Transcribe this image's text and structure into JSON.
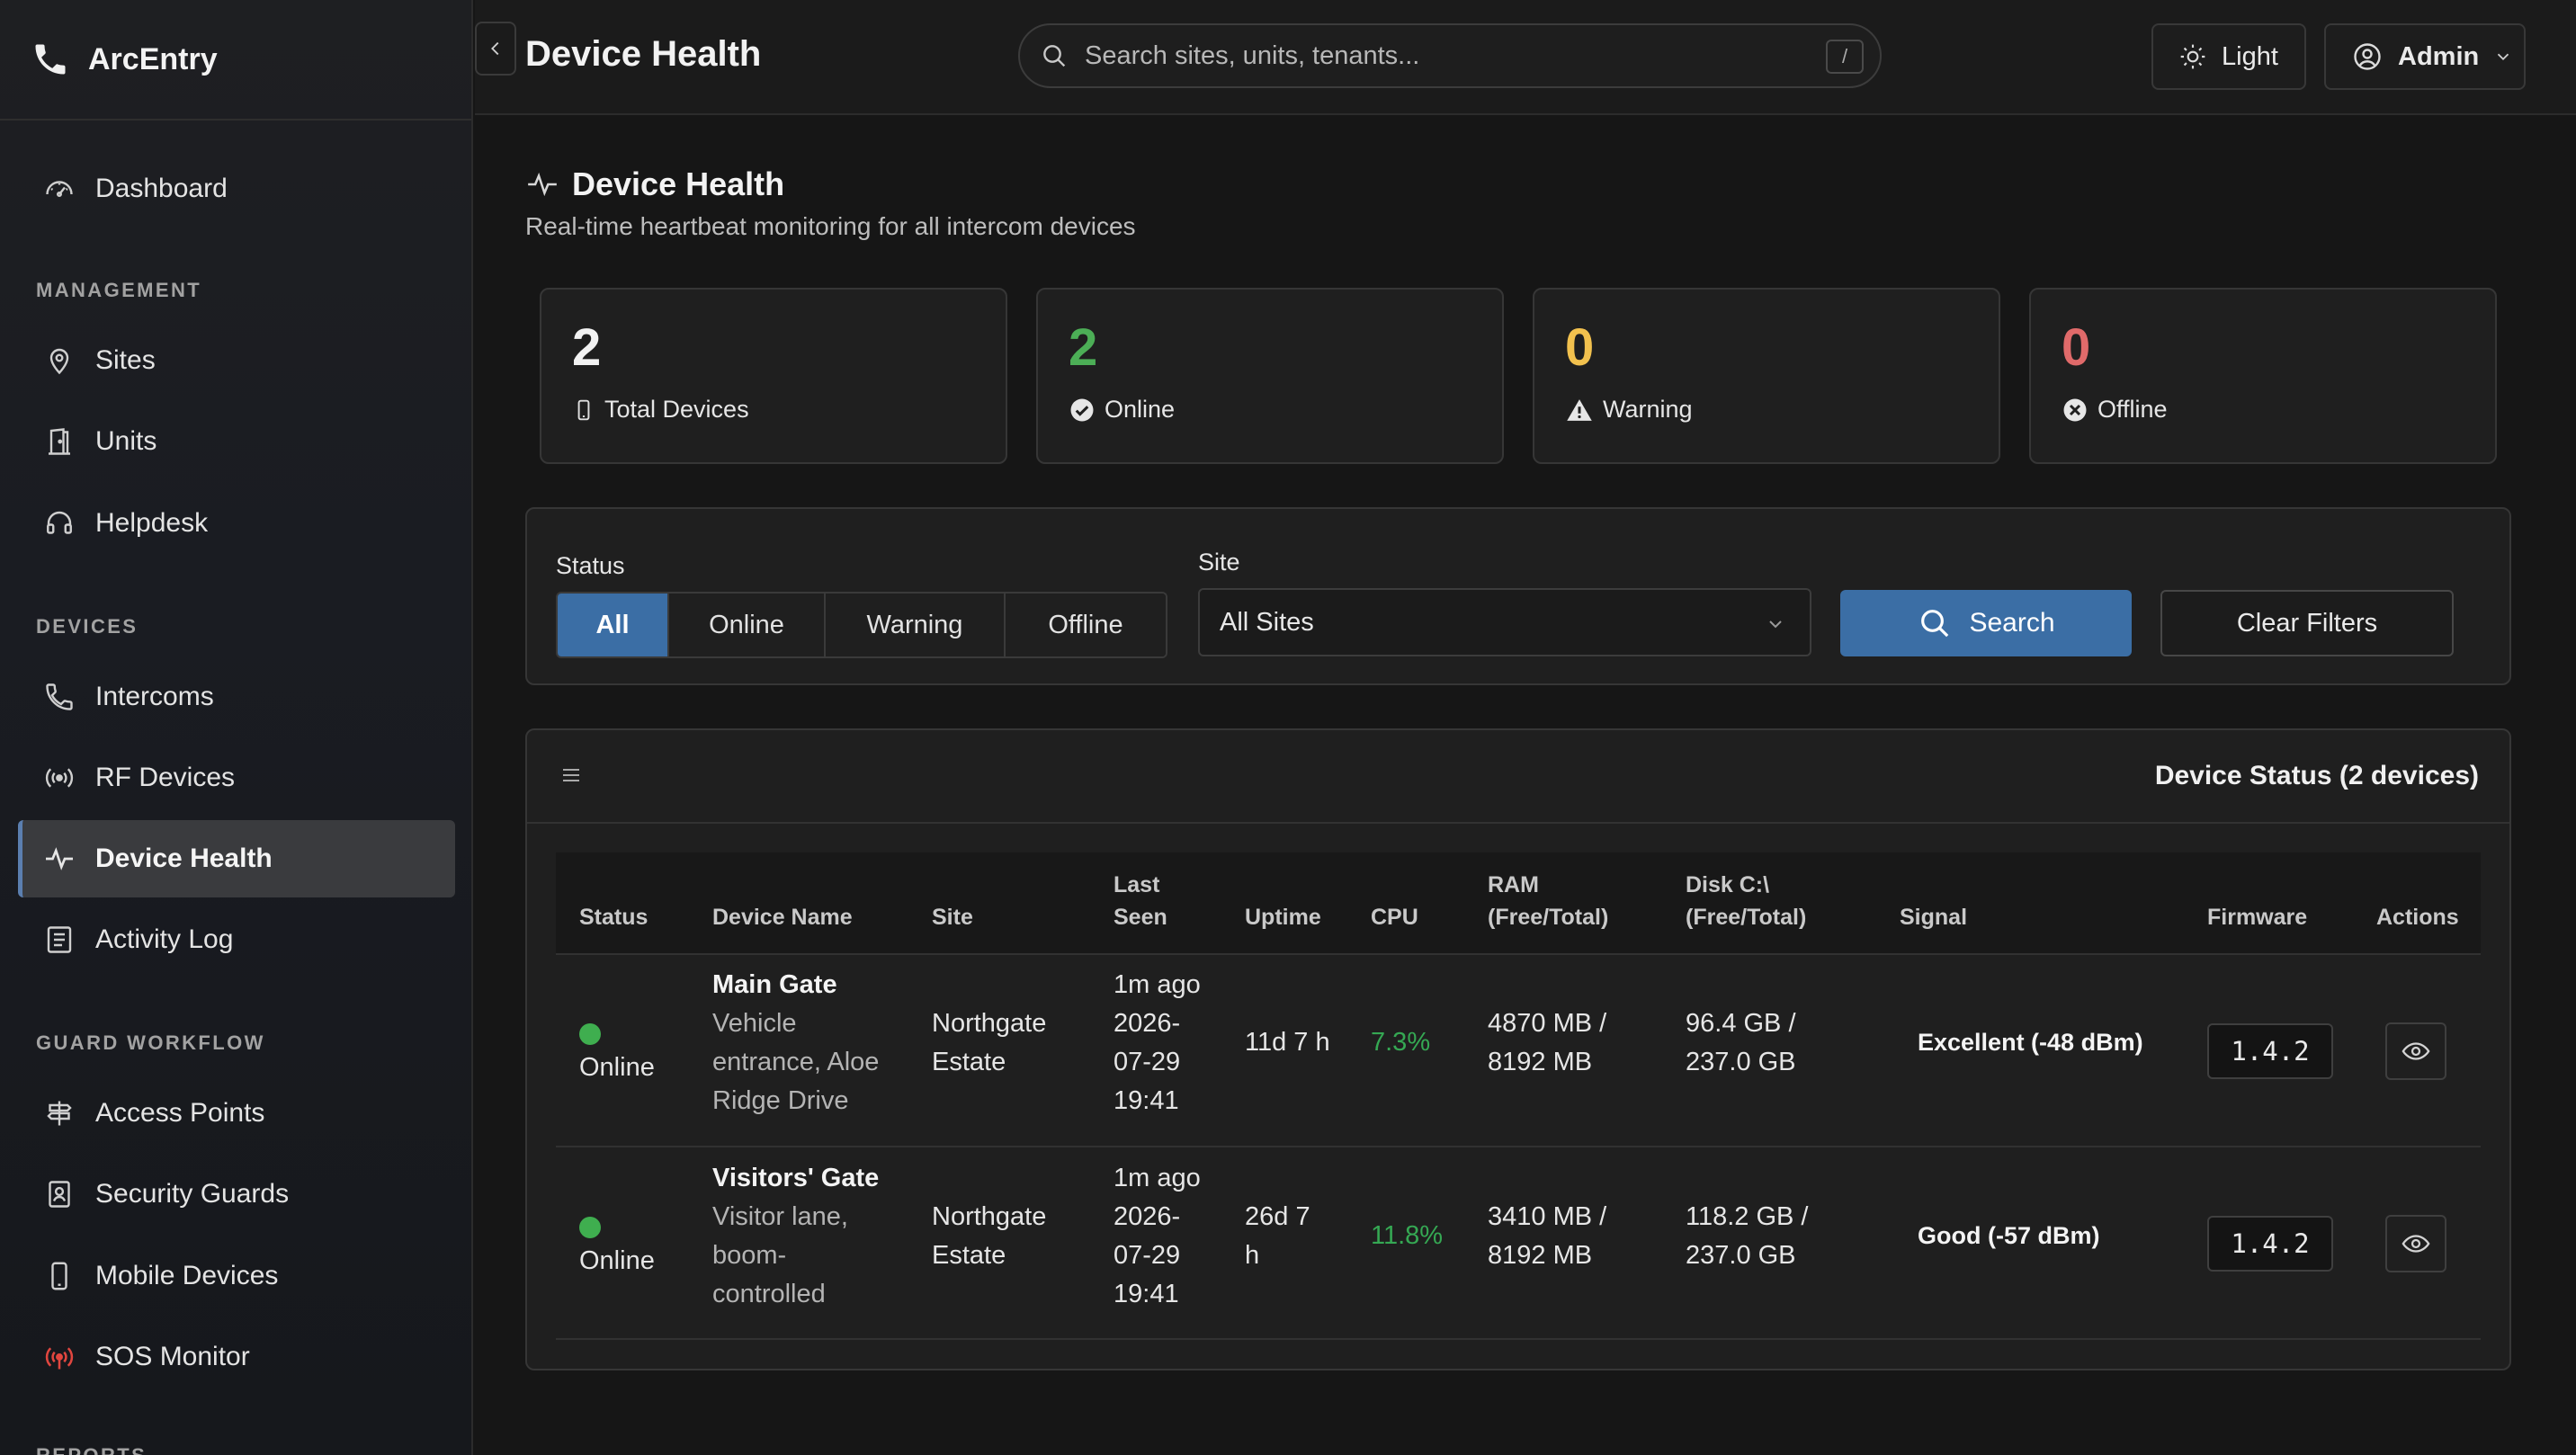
{
  "brand": {
    "name": "ArcEntry"
  },
  "sidebar": {
    "dashboard": "Dashboard",
    "sections": {
      "management": "MANAGEMENT",
      "devices": "DEVICES",
      "guard_workflow": "GUARD WORKFLOW",
      "reports": "REPORTS"
    },
    "management_items": [
      "Sites",
      "Units",
      "Helpdesk"
    ],
    "device_items": [
      "Intercoms",
      "RF Devices",
      "Device Health",
      "Activity Log"
    ],
    "guard_items": [
      "Access Points",
      "Security Guards",
      "Mobile Devices",
      "SOS Monitor"
    ],
    "active_item": "Device Health"
  },
  "header": {
    "title": "Device Health",
    "search_placeholder": "Search sites, units, tenants...",
    "search_shortcut": "/",
    "theme_label": "Light",
    "user_label": "Admin"
  },
  "page": {
    "title": "Device Health",
    "subtitle": "Real-time heartbeat monitoring for all intercom devices"
  },
  "stats": [
    {
      "value": "2",
      "label": "Total Devices",
      "color": "#f2f2f2"
    },
    {
      "value": "2",
      "label": "Online",
      "color": "#4cae56"
    },
    {
      "value": "0",
      "label": "Warning",
      "color": "#f2c14e"
    },
    {
      "value": "0",
      "label": "Offline",
      "color": "#e06a6a"
    }
  ],
  "filters": {
    "status_label": "Status",
    "status_options": [
      "All",
      "Online",
      "Warning",
      "Offline"
    ],
    "status_selected": "All",
    "site_label": "Site",
    "site_value": "All Sites",
    "search_button": "Search",
    "clear_button": "Clear Filters"
  },
  "table": {
    "title": "Device Status (2 devices)",
    "columns": {
      "status": "Status",
      "device_name": "Device Name",
      "site": "Site",
      "last_seen": [
        "Last",
        "Seen"
      ],
      "uptime": "Uptime",
      "cpu": "CPU",
      "ram": [
        "RAM",
        "(Free/Total)"
      ],
      "disk": [
        "Disk C:\\",
        "(Free/Total)"
      ],
      "signal": "Signal",
      "firmware": "Firmware",
      "actions": "Actions"
    },
    "rows": [
      {
        "status": "Online",
        "name": "Main Gate",
        "desc": [
          "Vehicle",
          "entrance, Aloe",
          "Ridge Drive"
        ],
        "site": [
          "Northgate",
          "Estate"
        ],
        "last_seen": [
          "1m ago",
          "2026-",
          "07-29",
          "19:41"
        ],
        "uptime": [
          "11d 7 h"
        ],
        "cpu": "7.3%",
        "ram": [
          "4870 MB /",
          "8192 MB"
        ],
        "disk": [
          "96.4 GB /",
          "237.0 GB"
        ],
        "signal": "Excellent (-48 dBm)",
        "firmware": "1.4.2"
      },
      {
        "status": "Online",
        "name": "Visitors' Gate",
        "desc": [
          "Visitor lane,",
          "boom-",
          "controlled"
        ],
        "site": [
          "Northgate",
          "Estate"
        ],
        "last_seen": [
          "1m ago",
          "2026-",
          "07-29",
          "19:41"
        ],
        "uptime": [
          "26d 7",
          "h"
        ],
        "cpu": "11.8%",
        "ram": [
          "3410 MB /",
          "8192 MB"
        ],
        "disk": [
          "118.2 GB /",
          "237.0 GB"
        ],
        "signal": "Good (-57 dBm)",
        "firmware": "1.4.2"
      }
    ]
  }
}
